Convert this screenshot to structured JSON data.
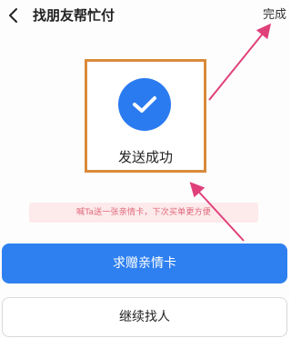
{
  "navbar": {
    "title": "找朋友帮忙付",
    "done_label": "完成"
  },
  "success": {
    "text": "发送成功"
  },
  "tip": {
    "text": "喊Ta送一张亲情卡，下次买单更方便"
  },
  "actions": {
    "primary_label": "求赠亲情卡",
    "secondary_label": "继续找人"
  },
  "colors": {
    "accent": "#2e80f0",
    "highlight_box": "#d98a3a",
    "annotation_arrow": "#e0407a",
    "tip_bg": "#fdeaea",
    "tip_text": "#e0677a"
  },
  "icons": {
    "back": "chevron-left-icon",
    "success": "check-circle-icon"
  }
}
